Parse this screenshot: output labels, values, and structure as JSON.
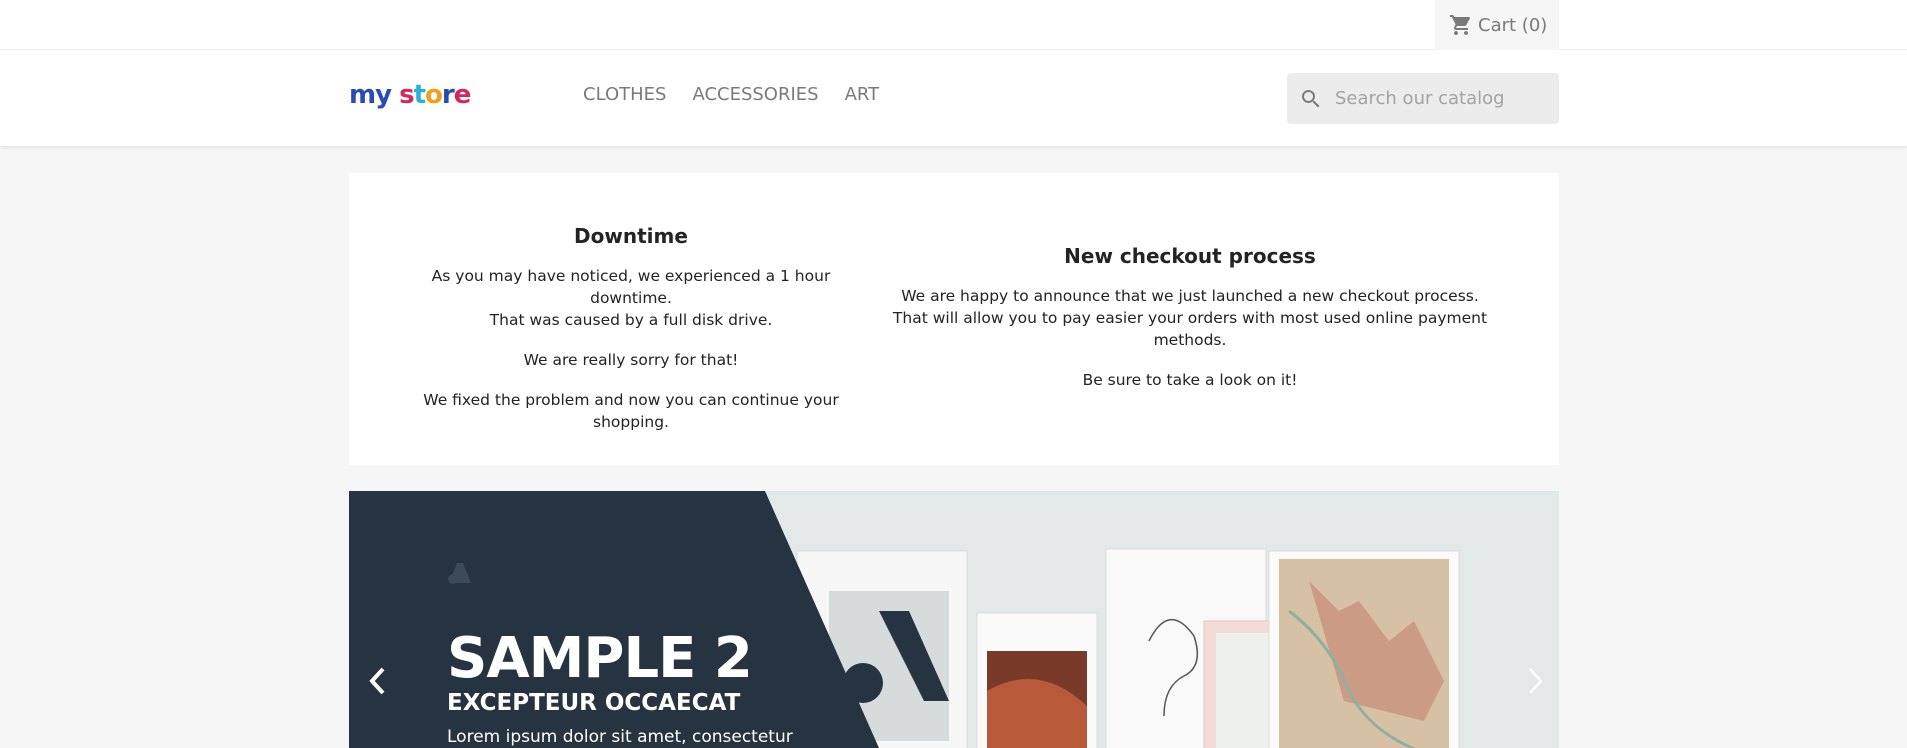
{
  "header": {
    "cart_label": "Cart",
    "cart_count": "(0)",
    "logo_text": "my store",
    "nav": [
      "CLOTHES",
      "ACCESSORIES",
      "ART"
    ],
    "search_placeholder": "Search our catalog"
  },
  "news": [
    {
      "title": "Downtime",
      "paragraphs": [
        "As you may have noticed, we experienced a 1 hour downtime.",
        "That was caused by a full disk drive.",
        "We are really sorry for that!",
        "We fixed the problem and now you can continue your shopping."
      ]
    },
    {
      "title": "New checkout process",
      "paragraphs": [
        "We are happy to announce that we just launched a new checkout process.",
        "That will allow you to pay easier your orders with most used online payment methods.",
        "Be sure to take a look on it!"
      ]
    }
  ],
  "slider": {
    "title": "SAMPLE 2",
    "subtitle": "EXCEPTEUR OCCAECAT",
    "text": "Lorem ipsum dolor sit amet, consectetur"
  },
  "colors": {
    "slide_dark": "#263340",
    "accent": "#24b9d7"
  }
}
